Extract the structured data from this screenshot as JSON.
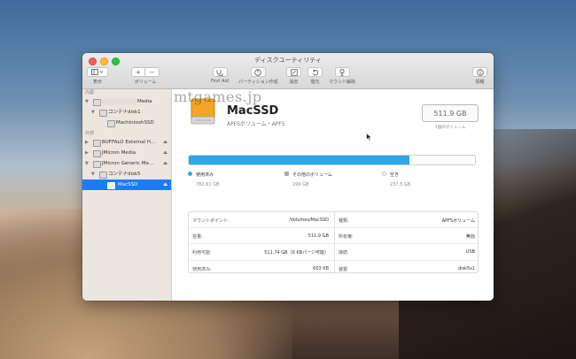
{
  "window": {
    "title": "ディスクユーティリティ"
  },
  "toolbar": {
    "view_label": "表示",
    "volume_label": "ボリューム",
    "plus": "+",
    "minus": "−",
    "firstaid_label": "First Aid",
    "partition_label": "パーティション作成",
    "erase_label": "消去",
    "restore_label": "復元",
    "unmount_label": "マウント解除",
    "info_label": "情報"
  },
  "sidebar": {
    "internal_header": "内蔵",
    "external_header": "外部",
    "items": [
      {
        "label": "Media",
        "indent": 0
      },
      {
        "label": "コンテナdisk1",
        "indent": 1
      },
      {
        "label": "MachintoshSSD",
        "indent": 2
      },
      {
        "label": "BUFFALO External H...",
        "indent": 0
      },
      {
        "label": "JMicron Media",
        "indent": 0
      },
      {
        "label": "JMicron Generic Me...",
        "indent": 0
      },
      {
        "label": "コンテナdisk5",
        "indent": 1
      },
      {
        "label": "MacSSD",
        "indent": 2
      }
    ],
    "eject": "⏏",
    "tri_open": "▼",
    "tri_closed": "▶"
  },
  "volume": {
    "name": "MacSSD",
    "subtitle": "APFSボリューム・APFS",
    "size": "511.9 GB",
    "size_sub": "1個のボリューム"
  },
  "usage": {
    "used_fraction": 0.77,
    "legend": [
      {
        "label": "使用済み",
        "value": "782.61 GB",
        "color": "#2ea7e8"
      },
      {
        "label": "その他のボリューム",
        "value": "299 GB",
        "color": "#a9a9a9"
      },
      {
        "label": "空き",
        "value": "237.5 GB",
        "color": "#ffffff"
      }
    ]
  },
  "watermark": "mtgames.jp",
  "info": {
    "left": [
      {
        "key": "マウントポイント:",
        "value": "/Volumes/MacSSD"
      },
      {
        "key": "容量:",
        "value": "511.9 GB"
      },
      {
        "key": "利用可能:",
        "value": "511.74 GB（0 KBパージ可能）"
      },
      {
        "key": "使用済み:",
        "value": "603 KB"
      }
    ],
    "right": [
      {
        "key": "種類:",
        "value": "APFSボリューム"
      },
      {
        "key": "所有権:",
        "value": "無効"
      },
      {
        "key": "接続:",
        "value": "USB"
      },
      {
        "key": "装置:",
        "value": "disk5s1"
      }
    ]
  }
}
